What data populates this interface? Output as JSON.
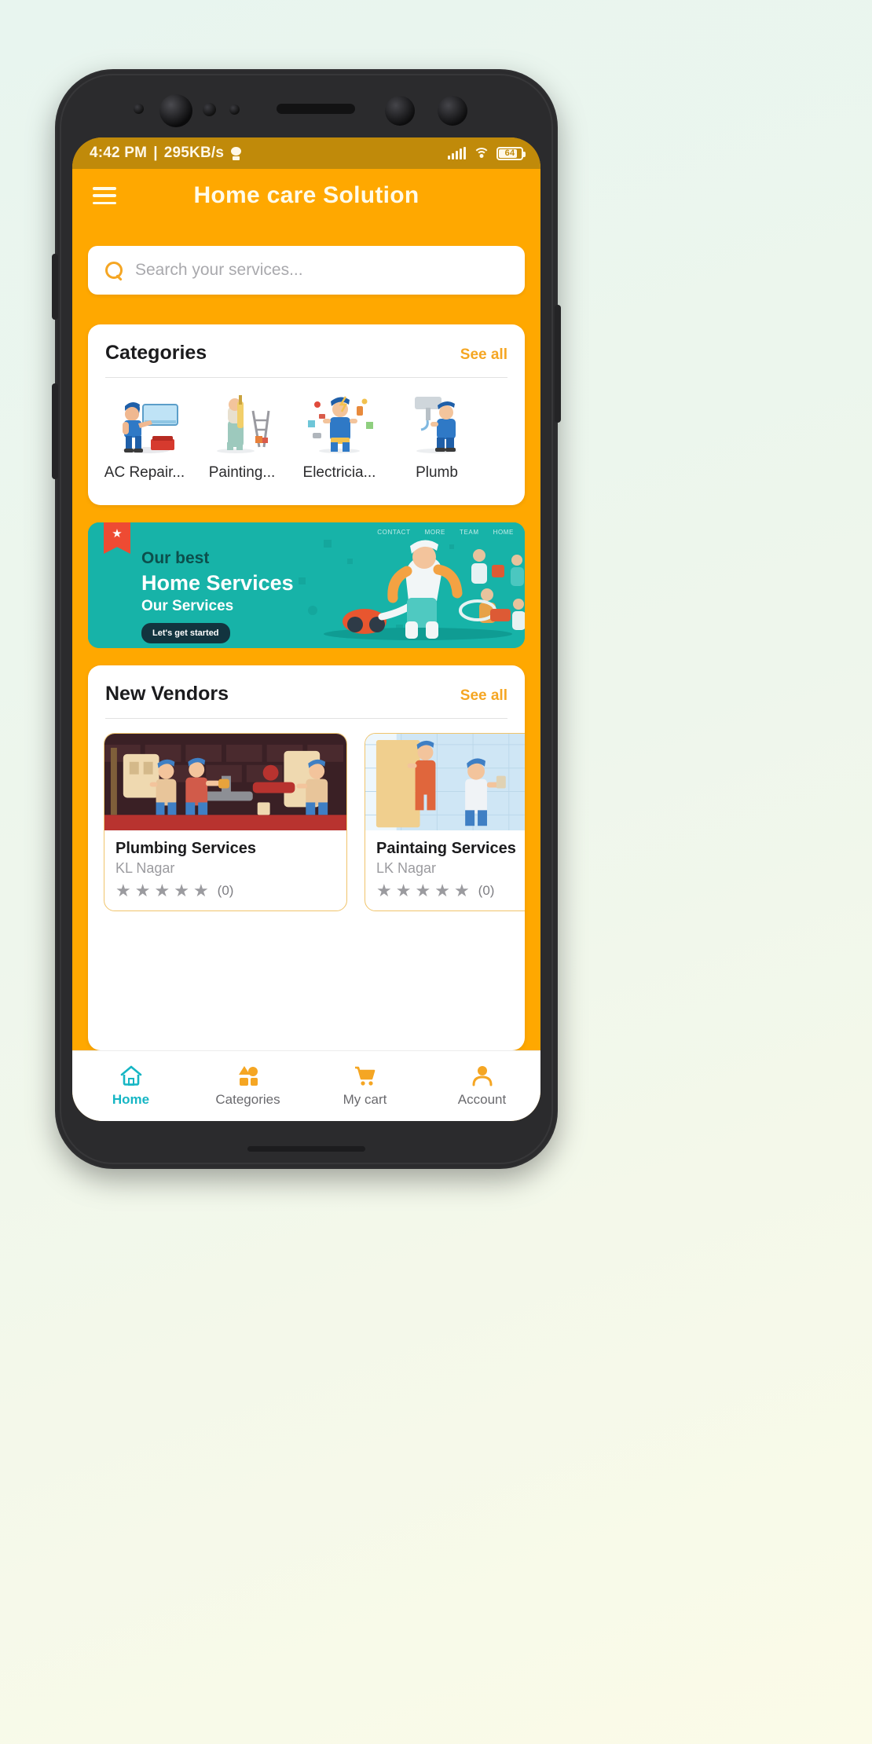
{
  "status_bar": {
    "time": "4:42 PM",
    "separator": "|",
    "network_speed": "295KB/s",
    "network_icon": "network-activity-icon",
    "signal_icon": "cellular-signal-icon",
    "wifi_icon": "wifi-icon",
    "battery_level": "64",
    "battery_icon": "battery-icon"
  },
  "app_bar": {
    "menu_icon": "hamburger-menu-icon",
    "title": "Home care Solution"
  },
  "search": {
    "icon": "search-icon",
    "placeholder": "Search your services...",
    "value": ""
  },
  "categories": {
    "title": "Categories",
    "see_all": "See all",
    "items": [
      {
        "label": "AC Repair...",
        "icon": "ac-repair-icon"
      },
      {
        "label": "Painting...",
        "icon": "painting-icon"
      },
      {
        "label": "Electricia...",
        "icon": "electrician-icon"
      },
      {
        "label": "Plumb",
        "icon": "plumbing-icon"
      }
    ]
  },
  "banner": {
    "ribbon_icon": "bookmark-ribbon-icon",
    "nav_links": [
      "CONTACT",
      "MORE",
      "TEAM",
      "HOME"
    ],
    "line1": "Our best",
    "line2": "Home Services",
    "line3": "Our Services",
    "cta": "Let's get started"
  },
  "vendors": {
    "title": "New Vendors",
    "see_all": "See all",
    "items": [
      {
        "name": "Plumbing Services",
        "location": "KL Nagar",
        "stars": 5,
        "filled_stars": 0,
        "rating_count": "(0)",
        "image": "plumbing-workers-illustration"
      },
      {
        "name": "Paintaing Services",
        "location": "LK Nagar",
        "stars": 5,
        "filled_stars": 0,
        "rating_count": "(0)",
        "image": "painting-workers-illustration"
      }
    ]
  },
  "bottom_nav": {
    "active_index": 0,
    "items": [
      {
        "label": "Home",
        "icon": "home-icon"
      },
      {
        "label": "Categories",
        "icon": "categories-icon"
      },
      {
        "label": "My cart",
        "icon": "shopping-cart-icon"
      },
      {
        "label": "Account",
        "icon": "account-person-icon"
      }
    ]
  },
  "colors": {
    "primary": "#FFA800",
    "status_bar": "#C08A0A",
    "accent": "#F5A623",
    "nav_active": "#16B6C4",
    "banner": "#17B3A8"
  }
}
